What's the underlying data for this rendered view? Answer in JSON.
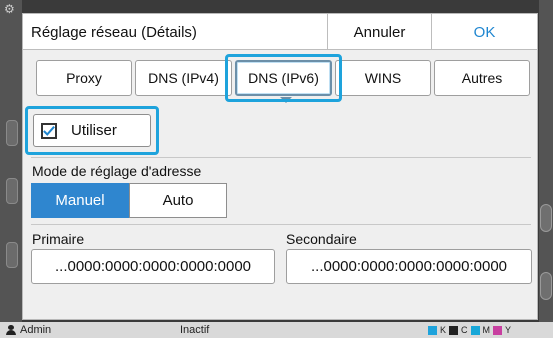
{
  "dialog": {
    "title": "Réglage réseau (Détails)",
    "cancel_label": "Annuler",
    "ok_label": "OK"
  },
  "tabs": [
    {
      "label": "Proxy",
      "selected": false
    },
    {
      "label": "DNS (IPv4)",
      "selected": false
    },
    {
      "label": "DNS (IPv6)",
      "selected": true
    },
    {
      "label": "WINS",
      "selected": false
    },
    {
      "label": "Autres",
      "selected": false
    }
  ],
  "use_checkbox": {
    "label": "Utiliser",
    "checked": true
  },
  "address_mode": {
    "label": "Mode de réglage d'adresse",
    "options": [
      "Manuel",
      "Auto"
    ],
    "selected": "Manuel"
  },
  "primary": {
    "label": "Primaire",
    "value": "...0000:0000:0000:0000:0000"
  },
  "secondary": {
    "label": "Secondaire",
    "value": "...0000:0000:0000:0000:0000"
  },
  "status_bar": {
    "user": "Admin",
    "state": "Inactif",
    "ink_labels": [
      "K",
      "C",
      "M",
      "Y"
    ]
  },
  "colors": {
    "accent": "#2f86cf",
    "highlight": "#1ea3dc",
    "ok_text": "#1f86d0"
  },
  "icons": [
    "gear-icon",
    "checkmark-icon",
    "user-icon"
  ]
}
